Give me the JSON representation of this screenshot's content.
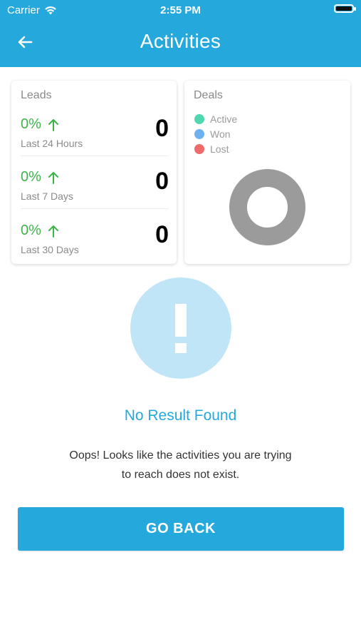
{
  "status_bar": {
    "carrier": "Carrier",
    "time": "2:55 PM"
  },
  "header": {
    "title": "Activities",
    "back_icon": "arrow-left-icon"
  },
  "leads": {
    "title": "Leads",
    "rows": [
      {
        "percent": "0%",
        "trend_icon": "arrow-up-icon",
        "period": "Last 24 Hours",
        "count": "0"
      },
      {
        "percent": "0%",
        "trend_icon": "arrow-up-icon",
        "period": "Last 7 Days",
        "count": "0"
      },
      {
        "percent": "0%",
        "trend_icon": "arrow-up-icon",
        "period": "Last 30 Days",
        "count": "0"
      }
    ]
  },
  "deals": {
    "title": "Deals",
    "legend": [
      {
        "label": "Active",
        "color": "#4fd8b0"
      },
      {
        "label": "Won",
        "color": "#6fb0ee"
      },
      {
        "label": "Lost",
        "color": "#f06a6a"
      }
    ],
    "donut_color": "#9b9b9b"
  },
  "empty_state": {
    "icon": "exclamation-icon",
    "title": "No Result Found",
    "message_line1": "Oops! Looks like the activities you are trying",
    "message_line2": "to reach does not exist."
  },
  "actions": {
    "go_back_label": "GO BACK"
  },
  "colors": {
    "primary": "#25a9dd",
    "positive": "#3db44a"
  }
}
